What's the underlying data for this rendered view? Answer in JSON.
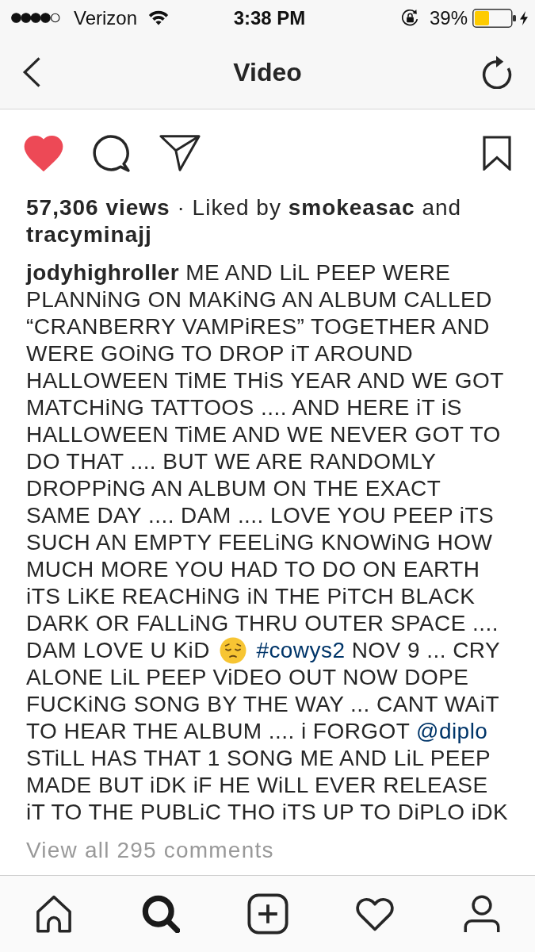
{
  "status_bar": {
    "carrier": "Verizon",
    "time": "3:38 PM",
    "battery": "39%"
  },
  "nav_bar": {
    "title": "Video"
  },
  "actions": {
    "liked": true,
    "saved": false
  },
  "likes": "**57,306 views** · Liked by **smokeasac** and **tracyminajj**",
  "caption": [
    {
      "kind": "username",
      "text": "jodyhighroller"
    },
    {
      "kind": "text",
      "text": "ME AND LiL PEEP WERE PLANNiNG ON MAKiNG AN ALBUM CALLED “CRANBERRY VAMPiRES” TOGETHER AND WERE GOiNG TO DROP iT AROUND HALLOWEEN TiME THiS YEAR AND WE GOT MATCHiNG TATTOOS .... AND HERE iT iS HALLOWEEN TiME AND WE NEVER GOT TO DO THAT .... BUT WE ARE RANDOMLY DROPPiNG AN ALBUM ON THE EXACT SAME DAY .... DAM .... LOVE YOU PEEP iTS SUCH AN EMPTY FEELiNG KNOWiNG HOW MUCH MORE YOU HAD TO DO ON EARTH iTS LiKE REACHiNG iN THE PiTCH BLACK DARK OR FALLiNG THRU OUTER SPACE .... DAM LOVE U KiD"
    },
    {
      "kind": "emoji"
    },
    {
      "kind": "hashtag",
      "text": "#cowys2"
    },
    {
      "kind": "text",
      "text": "NOV 9 ... CRY ALONE LiL PEEP ViDEO OUT NOW DOPE FUCKiNG SONG BY THE WAY ... CANT WAiT TO HEAR THE ALBUM .... i FORGOT"
    },
    {
      "kind": "mention",
      "text": "@diplo"
    },
    {
      "kind": "text",
      "text": "STiLL HAS THAT 1 SONG ME AND LiL PEEP MADE BUT iDK iF HE WiLL EVER RELEASE iT TO THE PUBLiC THO iTS UP TO DiPLO iDK"
    }
  ],
  "comments_link": "View all 295 comments",
  "tab_bar": {
    "tabs": [
      {
        "kind": "home",
        "selected": false
      },
      {
        "kind": "search",
        "selected": true
      },
      {
        "kind": "add",
        "selected": false
      },
      {
        "kind": "activity",
        "selected": false
      },
      {
        "kind": "profile",
        "selected": false
      }
    ]
  }
}
